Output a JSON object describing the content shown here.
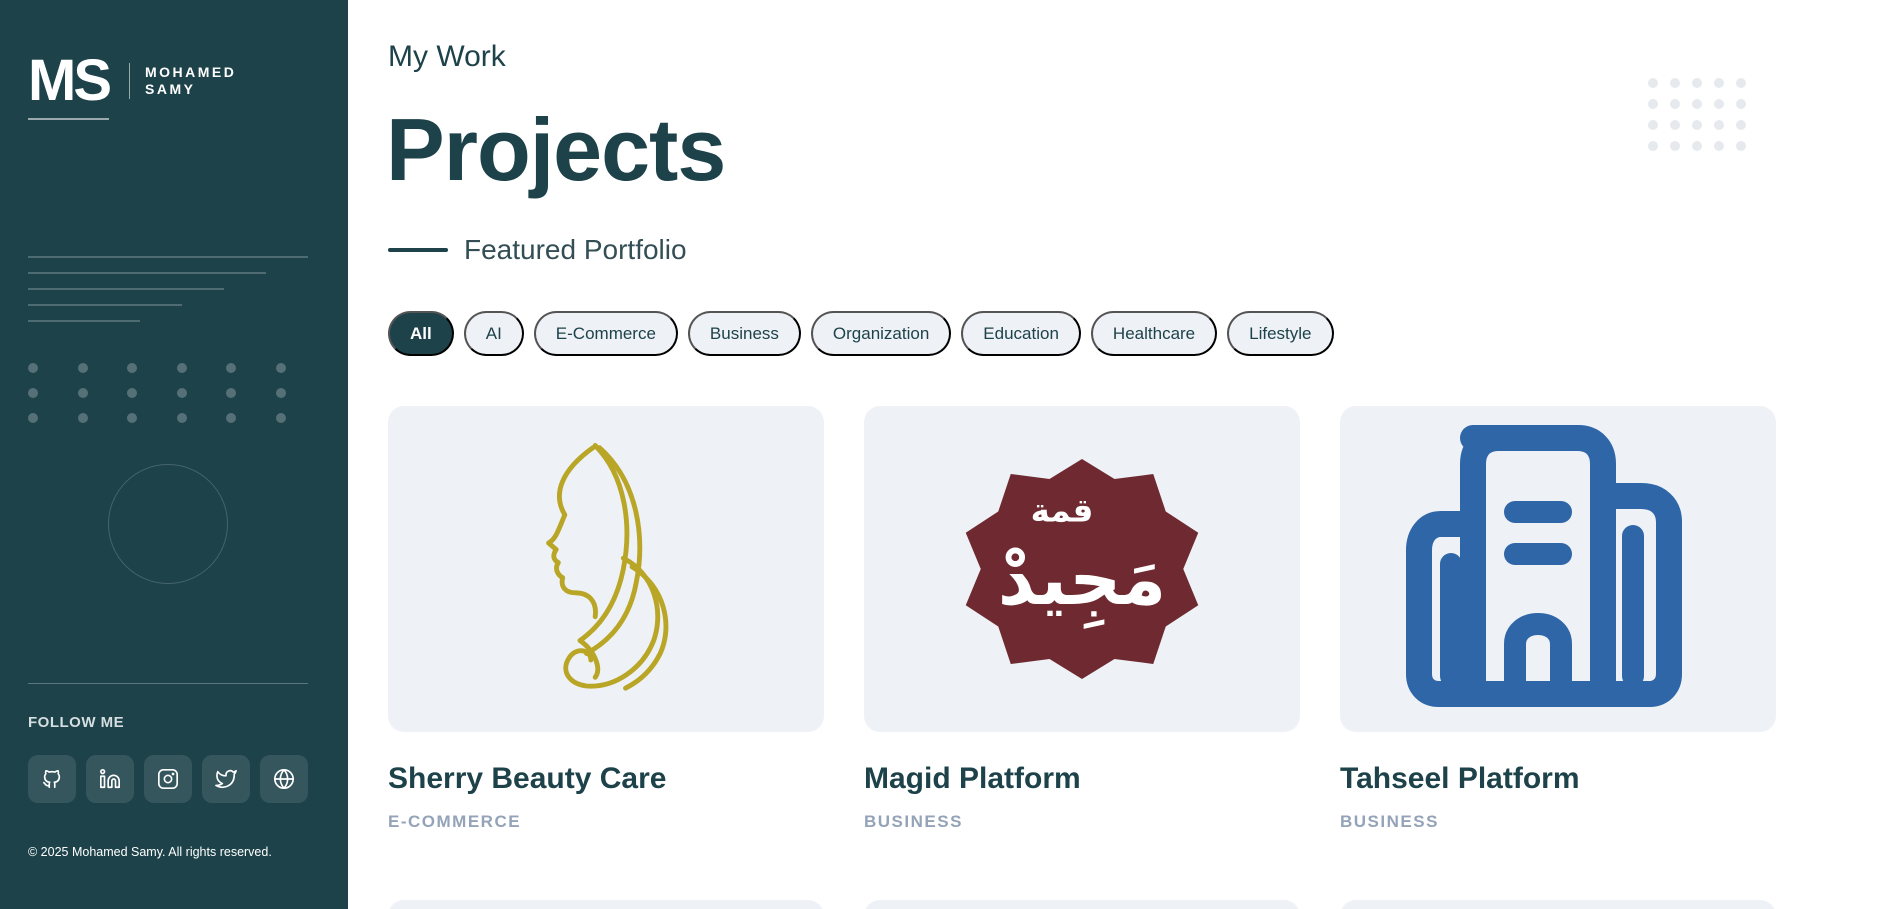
{
  "brand": {
    "mark": "MS",
    "name_line1": "MOHAMED",
    "name_line2": "SAMY"
  },
  "sidebar": {
    "follow_title": "FOLLOW ME",
    "social": [
      {
        "icon": "github-icon"
      },
      {
        "icon": "linkedin-icon"
      },
      {
        "icon": "instagram-icon"
      },
      {
        "icon": "twitter-icon"
      },
      {
        "icon": "globe-icon"
      }
    ],
    "copyright": "© 2025 Mohamed Samy. All rights reserved."
  },
  "header": {
    "subtitle": "My Work",
    "title": "Projects",
    "featured": "Featured Portfolio"
  },
  "filters": [
    "All",
    "AI",
    "E-Commerce",
    "Business",
    "Organization",
    "Education",
    "Healthcare",
    "Lifestyle"
  ],
  "active_filter": "All",
  "projects": [
    {
      "title": "Sherry Beauty Care",
      "category": "E-COMMERCE",
      "logo_color": "#b9a526"
    },
    {
      "title": "Magid Platform",
      "category": "BUSINESS",
      "logo_color": "#6e2a30",
      "logo_text_small": "قمة",
      "logo_text_large": "مَجِيدْ"
    },
    {
      "title": "Tahseel Platform",
      "category": "BUSINESS",
      "logo_color": "#2e66a8"
    }
  ],
  "quick_nav": [
    {
      "icon": "home-icon",
      "active": false
    },
    {
      "icon": "user-icon",
      "active": false
    },
    {
      "icon": "document-icon",
      "active": false
    },
    {
      "icon": "briefcase-icon",
      "active": true
    },
    {
      "icon": "mail-icon",
      "active": false
    }
  ],
  "colors": {
    "primary": "#1d424a",
    "chip_bg": "#eef1f6",
    "muted": "#94a3b8"
  }
}
